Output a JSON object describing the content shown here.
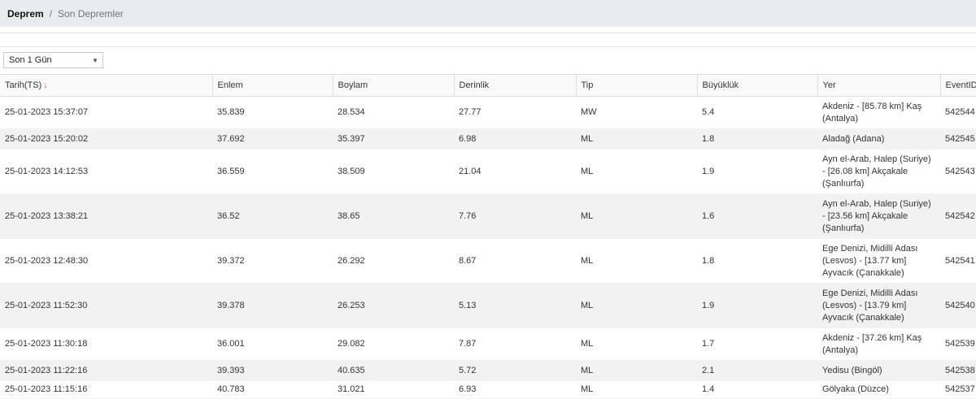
{
  "breadcrumb": {
    "root": "Deprem",
    "separator": "/",
    "current": "Son Depremler"
  },
  "filter": {
    "selected": "Son 1 Gün"
  },
  "table": {
    "columns": [
      "Tarih(TS)",
      "Enlem",
      "Boylam",
      "Derinlik",
      "Tip",
      "Büyüklük",
      "Yer",
      "EventID"
    ],
    "sort_indicator": "↓",
    "rows": [
      {
        "tarih": "25-01-2023 15:37:07",
        "enlem": "35.839",
        "boylam": "28.534",
        "derinlik": "27.77",
        "tip": "MW",
        "buyukluk": "5.4",
        "yer": "Akdeniz - [85.78 km] Kaş (Antalya)",
        "eventid": "542544"
      },
      {
        "tarih": "25-01-2023 15:20:02",
        "enlem": "37.692",
        "boylam": "35.397",
        "derinlik": "6.98",
        "tip": "ML",
        "buyukluk": "1.8",
        "yer": "Aladağ (Adana)",
        "eventid": "542545"
      },
      {
        "tarih": "25-01-2023 14:12:53",
        "enlem": "36.559",
        "boylam": "38.509",
        "derinlik": "21.04",
        "tip": "ML",
        "buyukluk": "1.9",
        "yer": "Ayn el-Arab, Halep (Suriye) - [26.08 km] Akçakale (Şanlıurfa)",
        "eventid": "542543"
      },
      {
        "tarih": "25-01-2023 13:38:21",
        "enlem": "36.52",
        "boylam": "38.65",
        "derinlik": "7.76",
        "tip": "ML",
        "buyukluk": "1.6",
        "yer": "Ayn el-Arab, Halep (Suriye) - [23.56 km] Akçakale (Şanlıurfa)",
        "eventid": "542542"
      },
      {
        "tarih": "25-01-2023 12:48:30",
        "enlem": "39.372",
        "boylam": "26.292",
        "derinlik": "8.67",
        "tip": "ML",
        "buyukluk": "1.8",
        "yer": "Ege Denizi, Midilli Adası (Lesvos) - [13.77 km] Ayvacık (Çanakkale)",
        "eventid": "542541"
      },
      {
        "tarih": "25-01-2023 11:52:30",
        "enlem": "39.378",
        "boylam": "26.253",
        "derinlik": "5.13",
        "tip": "ML",
        "buyukluk": "1.9",
        "yer": "Ege Denizi, Midilli Adası (Lesvos) - [13.79 km] Ayvacık (Çanakkale)",
        "eventid": "542540"
      },
      {
        "tarih": "25-01-2023 11:30:18",
        "enlem": "36.001",
        "boylam": "29.082",
        "derinlik": "7.87",
        "tip": "ML",
        "buyukluk": "1.7",
        "yer": "Akdeniz - [37.26 km] Kaş (Antalya)",
        "eventid": "542539"
      },
      {
        "tarih": "25-01-2023 11:22:16",
        "enlem": "39.393",
        "boylam": "40.635",
        "derinlik": "5.72",
        "tip": "ML",
        "buyukluk": "2.1",
        "yer": "Yedisu (Bingöl)",
        "eventid": "542538"
      },
      {
        "tarih": "25-01-2023 11:15:16",
        "enlem": "40.783",
        "boylam": "31.021",
        "derinlik": "6.93",
        "tip": "ML",
        "buyukluk": "1.4",
        "yer": "Gölyaka (Düzce)",
        "eventid": "542537"
      }
    ]
  }
}
